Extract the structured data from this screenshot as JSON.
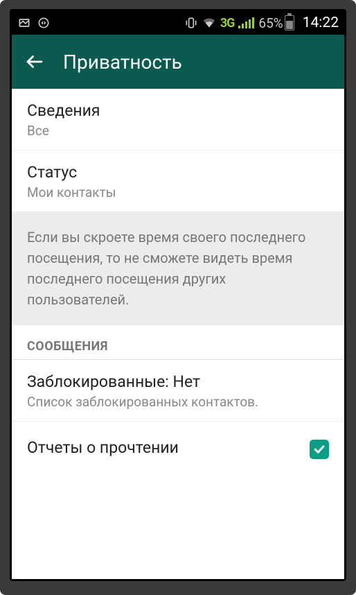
{
  "status_bar": {
    "network_label": "3G",
    "battery_percent": "65%",
    "time": "14:22"
  },
  "app_bar": {
    "title": "Приватность"
  },
  "settings": {
    "about": {
      "title": "Сведения",
      "value": "Все"
    },
    "status": {
      "title": "Статус",
      "value": "Мои контакты"
    },
    "info_text": "Если вы скроете время своего последнего посещения, то не сможете видеть время последнего посещения других пользователей.",
    "section_messages": "СООБЩЕНИЯ",
    "blocked": {
      "title": "Заблокированные: Нет",
      "subtitle": "Список заблокированных контактов."
    },
    "read_receipts": {
      "title": "Отчеты о прочтении",
      "checked": true
    }
  }
}
